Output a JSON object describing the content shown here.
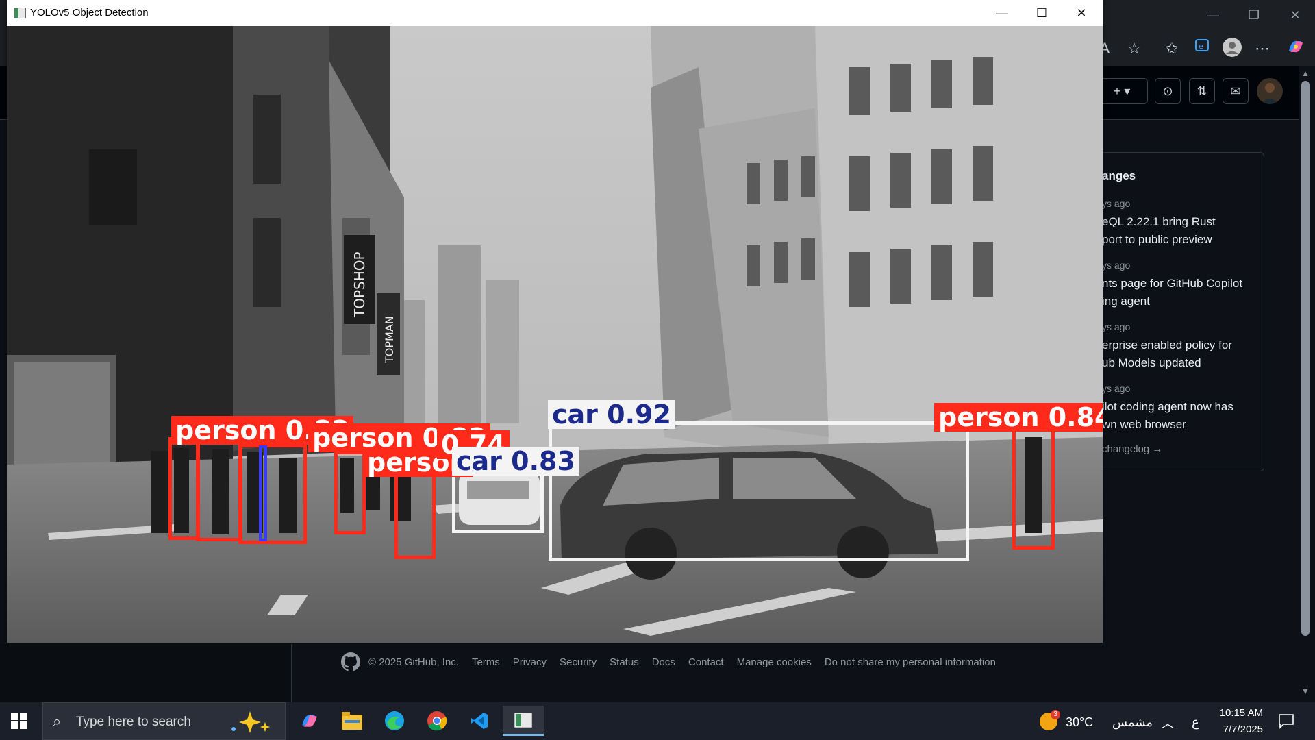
{
  "yolo": {
    "title": "YOLOv5 Object Detection",
    "controls": [
      "—",
      "☐",
      "✕"
    ],
    "detections": [
      {
        "label": "person 0.82"
      },
      {
        "label": "person 0.82"
      },
      {
        "label": "person"
      },
      {
        "label": "0.74"
      },
      {
        "label": "car 0.83"
      },
      {
        "label": "car 0.92"
      },
      {
        "label": "person 0.84"
      }
    ],
    "signs": [
      "TOPSHOP",
      "TOPMAN"
    ]
  },
  "github": {
    "changelog": {
      "title": "anges",
      "items": [
        {
          "time": "ys ago",
          "text": "eQL 2.22.1 bring Rust\nport to public preview"
        },
        {
          "time": "ys ago",
          "text": "nts page for GitHub Copilot\ning agent"
        },
        {
          "time": "ys ago",
          "text": "erprise enabled policy for\nub Models updated"
        },
        {
          "time": "ys ago",
          "text": "ilot coding agent now has\nwn web browser"
        }
      ],
      "more": "changelog →"
    },
    "footer": {
      "copyright": "© 2025 GitHub, Inc.",
      "links": [
        "Terms",
        "Privacy",
        "Security",
        "Status",
        "Docs",
        "Contact",
        "Manage cookies",
        "Do not share my personal information"
      ]
    }
  },
  "taskbar": {
    "search_placeholder": "Type here to search",
    "weather": "30°C",
    "weather_place": "مشمس",
    "weather_badge": "3",
    "lang": "ع",
    "time": "10:15 AM",
    "date": "7/7/2025"
  }
}
